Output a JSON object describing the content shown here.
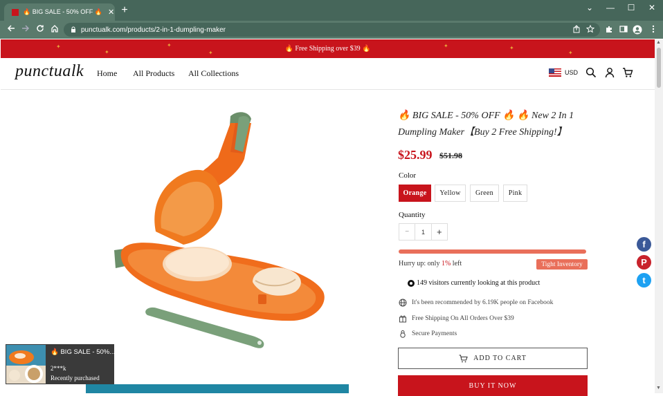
{
  "browser": {
    "tab_title": "🔥 BIG SALE - 50% OFF 🔥 🔥 New 2 In 1",
    "tab_close": "✕",
    "new_tab": "+",
    "url": "punctualk.com/products/2-in-1-dumpling-maker",
    "minimize": "—",
    "maximize": "☐",
    "close": "✕",
    "chevron": "⌄"
  },
  "banner": {
    "text": "🔥 Free Shipping over $39 🔥"
  },
  "header": {
    "logo": "punctualk",
    "nav": [
      "Home",
      "All Products",
      "All Collections"
    ],
    "currency": "USD"
  },
  "product": {
    "title": "🔥 BIG SALE - 50% OFF 🔥 🔥 New 2 In 1 Dumpling Maker【Buy 2 Free Shipping!】",
    "price": "$25.99",
    "compare_price": "$51.98",
    "color_label": "Color",
    "colors": [
      "Orange",
      "Yellow",
      "Green",
      "Pink"
    ],
    "selected_color": "Orange",
    "quantity_label": "Quantity",
    "qty_minus": "−",
    "quantity": "1",
    "qty_plus": "+",
    "stock_remaining": 0.98,
    "hurry_prefix": "Hurry up: only ",
    "hurry_count": "1%",
    "hurry_suffix": " left",
    "inventory_badge": "Tight Inventory",
    "visitors": "149 visitors currently looking at this product",
    "features": [
      "It's been recommended by 6.19K people on Facebook",
      "Free Shipping On All Orders Over $39",
      "Secure Payments"
    ],
    "add_to_cart": "ADD TO CART",
    "buy_now": "BUY IT NOW"
  },
  "social": {
    "facebook": "f",
    "pinterest": "P",
    "twitter": "t"
  },
  "popup": {
    "title": "🔥 BIG SALE - 50%...",
    "name": "2***k",
    "subtitle": "Recently purchased"
  },
  "colors": {
    "chrome": "#46665a",
    "brand_red": "#c8141c",
    "inventory": "#e96f5a",
    "facebook": "#3b5998",
    "pinterest": "#c8232c",
    "twitter": "#1da1f2"
  }
}
